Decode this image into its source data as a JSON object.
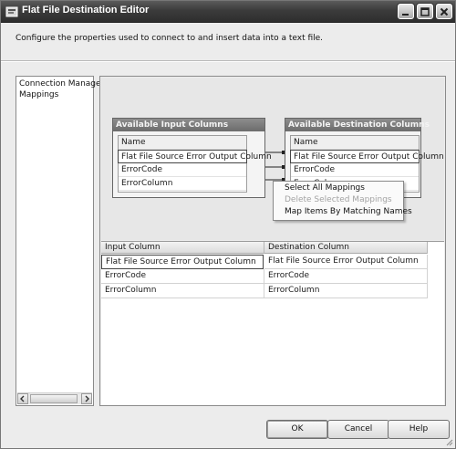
{
  "window": {
    "title": "Flat File Destination Editor"
  },
  "description": "Configure the properties used to connect to and insert data into a text file.",
  "nav": {
    "items": [
      {
        "label": "Connection Manager"
      },
      {
        "label": "Mappings"
      }
    ]
  },
  "input_columns": {
    "title": "Available Input Columns",
    "header": "Name",
    "rows": [
      "Flat File Source Error Output Column",
      "ErrorCode",
      "ErrorColumn"
    ]
  },
  "destination_columns": {
    "title": "Available Destination Columns",
    "header": "Name",
    "rows": [
      "Flat File Source Error Output Column",
      "ErrorCode",
      "ErrorColumn"
    ]
  },
  "context_menu": {
    "items": [
      {
        "label": "Select All Mappings",
        "enabled": true
      },
      {
        "label": "Delete Selected Mappings",
        "enabled": false
      },
      {
        "label": "Map Items By Matching Names",
        "enabled": true
      }
    ]
  },
  "mapping_grid": {
    "headers": [
      "Input Column",
      "Destination Column"
    ],
    "rows": [
      [
        "Flat File Source Error Output Column",
        "Flat File Source Error Output Column"
      ],
      [
        "ErrorCode",
        "ErrorCode"
      ],
      [
        "ErrorColumn",
        "ErrorColumn"
      ]
    ]
  },
  "buttons": {
    "ok": "OK",
    "cancel": "Cancel",
    "help": "Help"
  },
  "icons": {
    "title": "window-app-icon",
    "minimize": "minimize-icon",
    "maximize": "maximize-icon",
    "close": "close-icon"
  }
}
